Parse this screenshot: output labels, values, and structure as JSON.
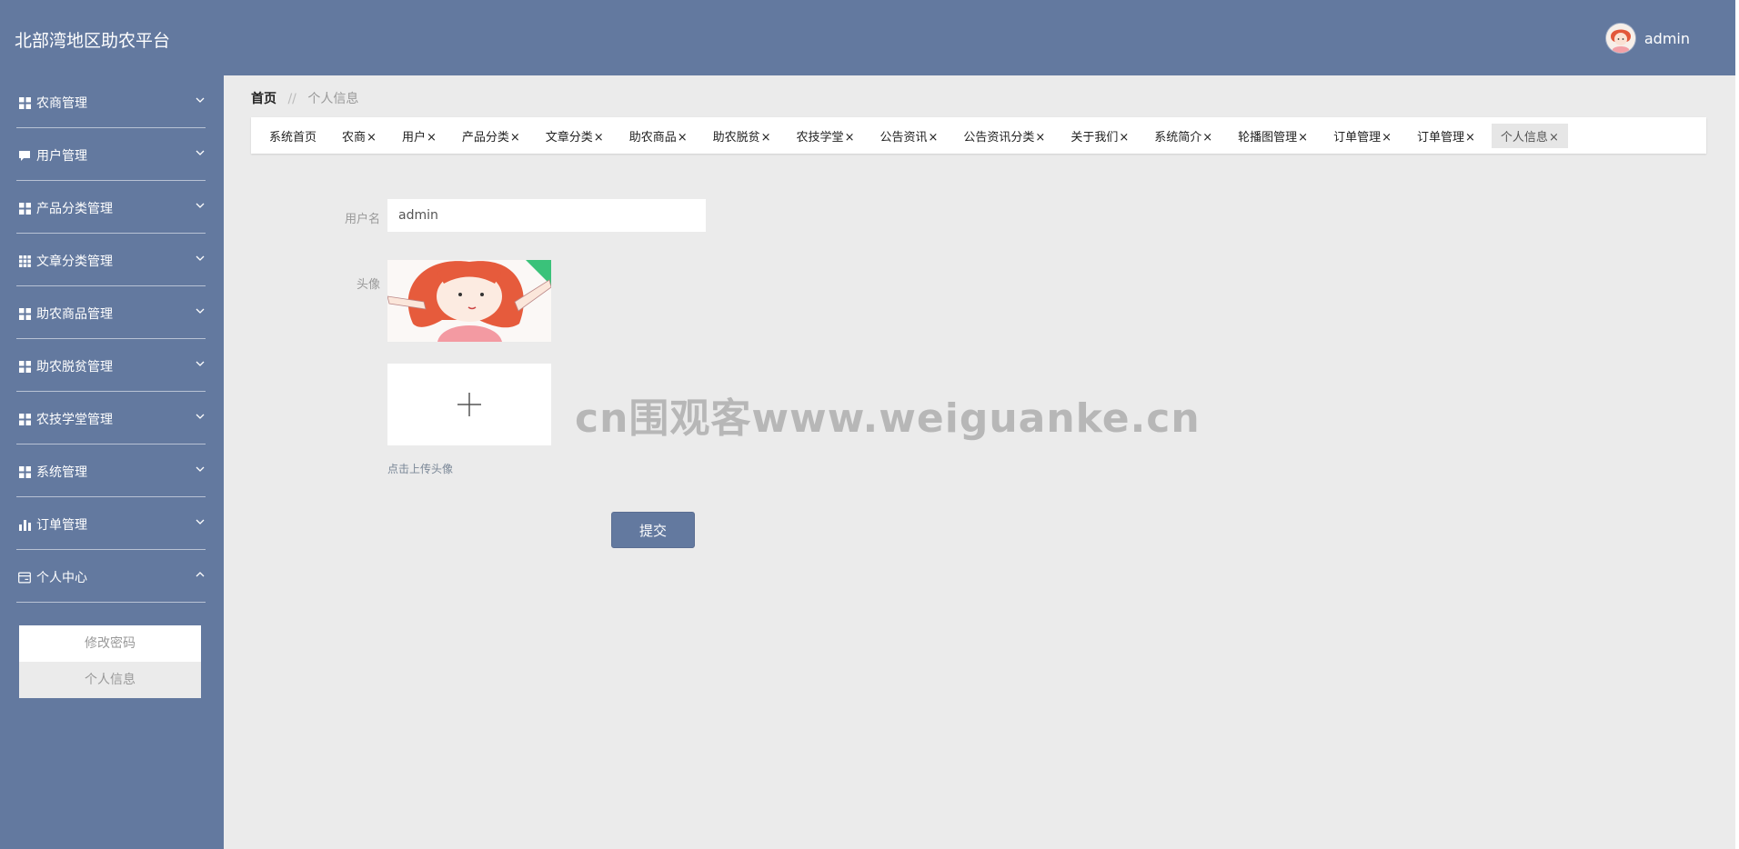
{
  "app": {
    "title": "北部湾地区助农平台",
    "user_name": "admin"
  },
  "sidebar": {
    "items": [
      {
        "label": "农商管理",
        "icon": "grid-icon"
      },
      {
        "label": "用户管理",
        "icon": "chat-icon"
      },
      {
        "label": "产品分类管理",
        "icon": "grid-icon"
      },
      {
        "label": "文章分类管理",
        "icon": "table-icon"
      },
      {
        "label": "助农商品管理",
        "icon": "grid-icon"
      },
      {
        "label": "助农脱贫管理",
        "icon": "grid-icon"
      },
      {
        "label": "农技学堂管理",
        "icon": "grid-icon"
      },
      {
        "label": "系统管理",
        "icon": "grid-icon"
      },
      {
        "label": "订单管理",
        "icon": "bar-chart-icon"
      },
      {
        "label": "个人中心",
        "icon": "card-icon",
        "expanded": true
      }
    ],
    "submenu": [
      {
        "label": "修改密码",
        "active": false
      },
      {
        "label": "个人信息",
        "active": true
      }
    ]
  },
  "breadcrumb": {
    "home": "首页",
    "separator": "//",
    "current": "个人信息"
  },
  "tabs": [
    {
      "label": "系统首页",
      "closable": false,
      "active": false
    },
    {
      "label": "农商",
      "closable": true,
      "active": false
    },
    {
      "label": "用户",
      "closable": true,
      "active": false
    },
    {
      "label": "产品分类",
      "closable": true,
      "active": false
    },
    {
      "label": "文章分类",
      "closable": true,
      "active": false
    },
    {
      "label": "助农商品",
      "closable": true,
      "active": false
    },
    {
      "label": "助农脱贫",
      "closable": true,
      "active": false
    },
    {
      "label": "农技学堂",
      "closable": true,
      "active": false
    },
    {
      "label": "公告资讯",
      "closable": true,
      "active": false
    },
    {
      "label": "公告资讯分类",
      "closable": true,
      "active": false
    },
    {
      "label": "关于我们",
      "closable": true,
      "active": false
    },
    {
      "label": "系统简介",
      "closable": true,
      "active": false
    },
    {
      "label": "轮播图管理",
      "closable": true,
      "active": false
    },
    {
      "label": "订单管理",
      "closable": true,
      "active": false
    },
    {
      "label": "订单管理",
      "closable": true,
      "active": false
    },
    {
      "label": "个人信息",
      "closable": true,
      "active": true
    }
  ],
  "form": {
    "username_label": "用户名",
    "username_value": "admin",
    "avatar_label": "头像",
    "upload_hint": "点击上传头像",
    "submit_label": "提交"
  },
  "watermark": "cn围观客www.weiguanke.cn",
  "colors": {
    "primary": "#63799f",
    "background": "#ebebeb",
    "panel": "#ffffff"
  }
}
